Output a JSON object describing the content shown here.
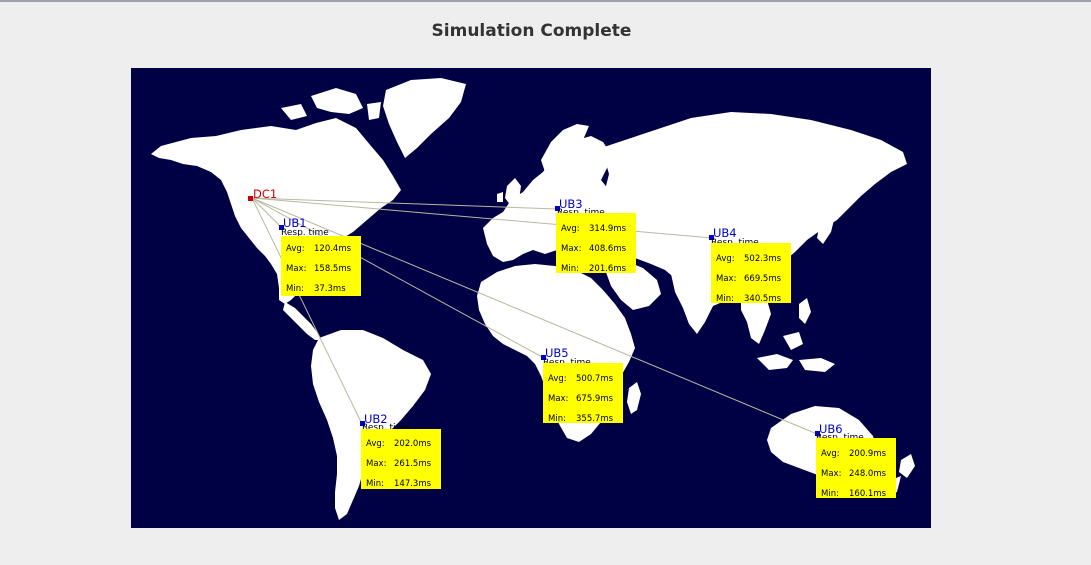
{
  "page": {
    "title": "Simulation Complete"
  },
  "colors": {
    "background": "#eeeeee",
    "map_ocean": "#000044",
    "land": "#ffffff",
    "datacenter": "#cc0000",
    "userbase": "#0000cc",
    "stats_box": "#ffff00",
    "connection_line": "#b8b8a0"
  },
  "datacenters": [
    {
      "id": "DC1",
      "label": "DC1"
    }
  ],
  "userbases": [
    {
      "id": "UB1",
      "label": "UB1",
      "resp_label": "Resp. time",
      "avg_key": "Avg:",
      "avg": "120.4ms",
      "max_key": "Max:",
      "max": "158.5ms",
      "min_key": "Min:",
      "min": "37.3ms"
    },
    {
      "id": "UB2",
      "label": "UB2",
      "resp_label": "Resp. time",
      "avg_key": "Avg:",
      "avg": "202.0ms",
      "max_key": "Max:",
      "max": "261.5ms",
      "min_key": "Min:",
      "min": "147.3ms"
    },
    {
      "id": "UB3",
      "label": "UB3",
      "resp_label": "Resp. time",
      "avg_key": "Avg:",
      "avg": "314.9ms",
      "max_key": "Max:",
      "max": "408.6ms",
      "min_key": "Min:",
      "min": "201.6ms"
    },
    {
      "id": "UB4",
      "label": "UB4",
      "resp_label": "Resp. time",
      "avg_key": "Avg:",
      "avg": "502.3ms",
      "max_key": "Max:",
      "max": "669.5ms",
      "min_key": "Min:",
      "min": "340.5ms"
    },
    {
      "id": "UB5",
      "label": "UB5",
      "resp_label": "Resp. time",
      "avg_key": "Avg:",
      "avg": "500.7ms",
      "max_key": "Max:",
      "max": "675.9ms",
      "min_key": "Min:",
      "min": "355.7ms"
    },
    {
      "id": "UB6",
      "label": "UB6",
      "resp_label": "Resp. time",
      "avg_key": "Avg:",
      "avg": "200.9ms",
      "max_key": "Max:",
      "max": "248.0ms",
      "min_key": "Min:",
      "min": "160.1ms"
    }
  ]
}
